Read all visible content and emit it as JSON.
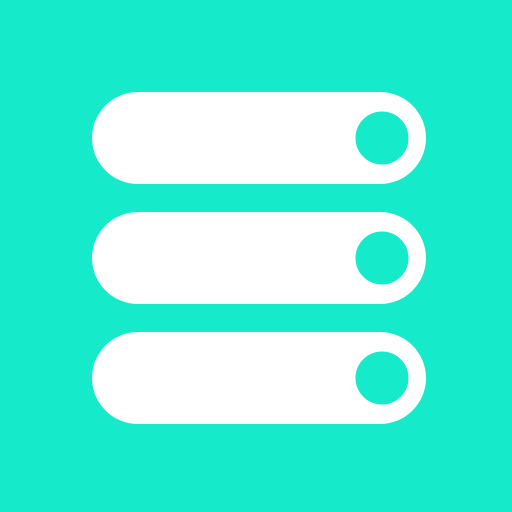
{
  "icon": {
    "name": "toggle-list-icon",
    "colors": {
      "background": "#15EACB",
      "track": "#FFFFFF",
      "knob_fill": "#15EACB",
      "knob_ring": "#FFFFFF"
    },
    "toggles": [
      {
        "name": "toggle-1",
        "state": "on"
      },
      {
        "name": "toggle-2",
        "state": "on"
      },
      {
        "name": "toggle-3",
        "state": "on"
      }
    ]
  }
}
